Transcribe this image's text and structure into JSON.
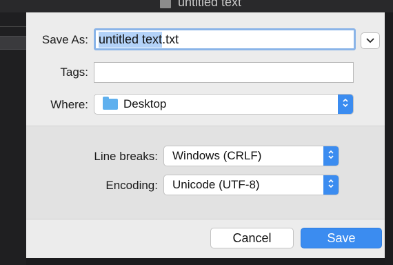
{
  "window": {
    "title": "untitled text"
  },
  "dialog": {
    "save_as_label": "Save As:",
    "filename_selected": "untitled text",
    "filename_ext": ".txt",
    "tags_label": "Tags:",
    "tags_value": "",
    "where_label": "Where:",
    "where_value": "Desktop",
    "line_breaks_label": "Line breaks:",
    "line_breaks_value": "Windows (CRLF)",
    "encoding_label": "Encoding:",
    "encoding_value": "Unicode (UTF-8)",
    "cancel_label": "Cancel",
    "save_label": "Save"
  },
  "icons": {
    "expand": "chevron-down-icon",
    "folder": "folder-icon",
    "stepper": "up-down-chevron-icon",
    "document": "document-icon"
  },
  "colors": {
    "accent": "#3b8cf0",
    "selection": "#b3d2f8",
    "focus_ring": "#8ab4e8"
  }
}
